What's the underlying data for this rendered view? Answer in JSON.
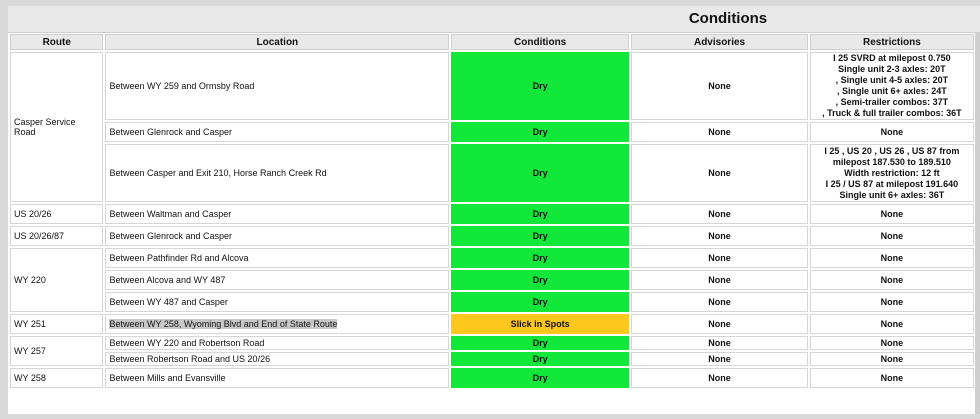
{
  "section_title": "Conditions",
  "headers": {
    "route": "Route",
    "location": "Location",
    "conditions": "Conditions",
    "advisories": "Advisories",
    "restrictions": "Restrictions"
  },
  "routes": {
    "casper_service_road": "Casper Service Road",
    "us_20_26": "US 20/26",
    "us_20_26_87": "US 20/26/87",
    "wy_220": "WY 220",
    "wy_251": "WY 251",
    "wy_257": "WY 257",
    "wy_258": "WY 258"
  },
  "rows": [
    {
      "location": "Between WY 259 and Ormsby Road",
      "condition": "Dry",
      "advisory": "None",
      "restriction_lines": [
        "I 25 SVRD at milepost 0.750",
        "Single unit 2-3 axles: 20T",
        ", Single unit 4-5 axles: 20T",
        ", Single unit 6+ axles: 24T",
        ", Semi-trailer combos: 37T",
        ", Truck & full trailer combos: 36T"
      ]
    },
    {
      "location": "Between Glenrock and Casper",
      "condition": "Dry",
      "advisory": "None",
      "restriction": "None"
    },
    {
      "location": "Between Casper and Exit 210, Horse Ranch Creek Rd",
      "condition": "Dry",
      "advisory": "None",
      "restriction_lines": [
        "I 25 , US 20 , US 26 , US 87 from",
        "milepost 187.530 to 189.510",
        "Width restriction: 12 ft",
        "I 25 / US 87 at milepost 191.640",
        "Single unit 6+ axles: 36T"
      ]
    },
    {
      "location": "Between Waltman and Casper",
      "condition": "Dry",
      "advisory": "None",
      "restriction": "None"
    },
    {
      "location": "Between Glenrock and Casper",
      "condition": "Dry",
      "advisory": "None",
      "restriction": "None"
    },
    {
      "location": "Between Pathfinder Rd and Alcova",
      "condition": "Dry",
      "advisory": "None",
      "restriction": "None"
    },
    {
      "location": "Between Alcova and WY 487",
      "condition": "Dry",
      "advisory": "None",
      "restriction": "None"
    },
    {
      "location": "Between WY 487 and Casper",
      "condition": "Dry",
      "advisory": "None",
      "restriction": "None"
    },
    {
      "location": "Between WY 258, Wyoming Blvd and End of State Route",
      "condition": "Slick in Spots",
      "advisory": "None",
      "restriction": "None"
    },
    {
      "location": "Between WY 220 and Robertson Road",
      "condition": "Dry",
      "advisory": "None",
      "restriction": "None"
    },
    {
      "location": "Between Robertson Road and US 20/26",
      "condition": "Dry",
      "advisory": "None",
      "restriction": "None"
    },
    {
      "location": "Between Mills and Evansville",
      "condition": "Dry",
      "advisory": "None",
      "restriction": "None"
    }
  ],
  "colors": {
    "dry": "#12e83a",
    "slick": "#fec71d",
    "header_bg": "#e9e9e9"
  }
}
